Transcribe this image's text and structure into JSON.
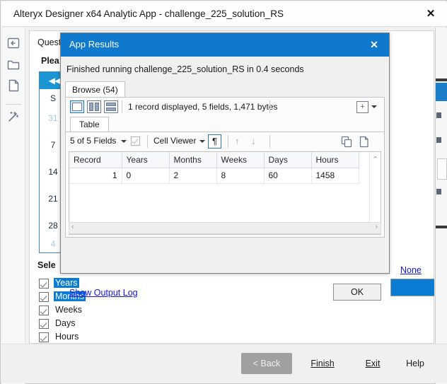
{
  "window": {
    "title": "Alteryx Designer x64 Analytic App - challenge_225_solution_RS",
    "close_label": "✕"
  },
  "rail": {
    "icons": [
      "collapse-panel-icon",
      "folder-icon",
      "document-icon",
      "magic-wand-icon"
    ]
  },
  "wizard": {
    "question_label": "Quest",
    "please_label": "Plea",
    "select_label": "Sele",
    "none_link": "None",
    "calendar": {
      "nav_label": "◀◀",
      "day_header": "S",
      "days": [
        "31",
        "7",
        "14",
        "21",
        "28",
        "4"
      ],
      "dim_days": [
        "31",
        "4"
      ]
    },
    "checkboxes": [
      {
        "label": "Years",
        "checked": true,
        "selected": true
      },
      {
        "label": "Months",
        "checked": true,
        "selected": true
      },
      {
        "label": "Weeks",
        "checked": true,
        "selected": false
      },
      {
        "label": "Days",
        "checked": true,
        "selected": false
      },
      {
        "label": "Hours",
        "checked": true,
        "selected": false
      }
    ]
  },
  "footer": {
    "back": "< Back",
    "finish": "Finish",
    "exit": "Exit",
    "help": "Help"
  },
  "modal": {
    "title": "App Results",
    "close_label": "✕",
    "status": "Finished running challenge_225_solution_RS in 0.4 seconds",
    "browse_tab": "Browse (54)",
    "table_tab": "Table",
    "record_info": "1 record displayed, 5 fields, 1,471 bytes",
    "fields_label": "5 of 5 Fields",
    "cell_viewer": "Cell Viewer",
    "pilcrow": "¶",
    "arrow_up": "↑",
    "arrow_down": "↓",
    "scroll_up": "⌃",
    "scroll_down": "⌄",
    "scroll_left": "‹",
    "scroll_right": "›",
    "show_output_log": "Show Output Log",
    "ok": "OK",
    "grid_button_icon": "add-column-icon",
    "copy_icon": "copy-icon",
    "new_page_icon": "new-document-icon",
    "table": {
      "columns": [
        "Record",
        "Years",
        "Months",
        "Weeks",
        "Days",
        "Hours"
      ],
      "rows": [
        [
          "1",
          "0",
          "2",
          "8",
          "60",
          "1458"
        ]
      ]
    }
  },
  "colors": {
    "accent_blue": "#0f79cd",
    "calendar_header": "#1a96d5",
    "selection_blue": "#0a7cd4",
    "link_blue": "#1414e0"
  }
}
